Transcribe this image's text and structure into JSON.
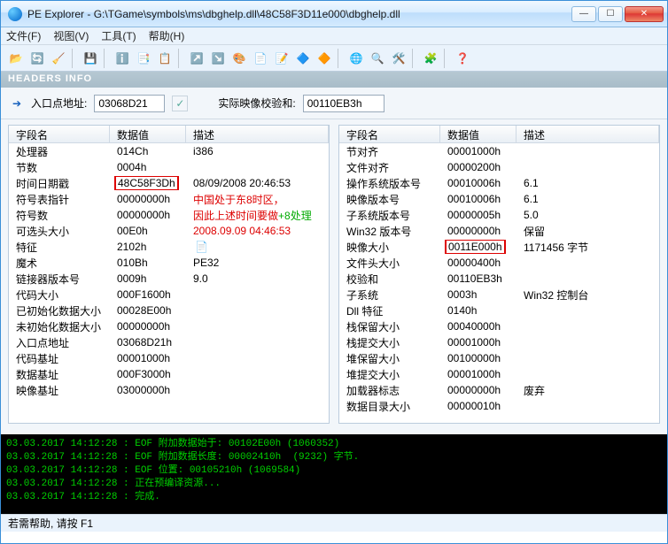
{
  "titlebar": {
    "title": "PE Explorer - G:\\TGame\\symbols\\ms\\dbghelp.dll\\48C58F3D11e000\\dbghelp.dll"
  },
  "menu": {
    "file": "文件(F)",
    "view": "视图(V)",
    "tools": "工具(T)",
    "help": "帮助(H)"
  },
  "headersInfo": "HEADERS INFO",
  "entrybar": {
    "ep_label": "入口点地址:",
    "ep_value": "03068D21",
    "checksum_label": "实际映像校验和:",
    "checksum_value": "00110EB3h"
  },
  "leftColumns": {
    "c1": "字段名",
    "c2": "数据值",
    "c3": "描述"
  },
  "rightColumns": {
    "c1": "字段名",
    "c2": "数据值",
    "c3": "描述"
  },
  "leftRows": [
    {
      "name": "处理器",
      "value": "014Ch",
      "desc": "i386"
    },
    {
      "name": "节数",
      "value": "0004h",
      "desc": ""
    },
    {
      "name": "时间日期戳",
      "value": "48C58F3Dh",
      "desc": "08/09/2008 20:46:53",
      "vbox": true
    },
    {
      "name": "符号表指针",
      "value": "00000000h",
      "desc": "中国处于东8时区，",
      "red": true
    },
    {
      "name": "符号数",
      "value": "00000000h",
      "desc": "因此上述时间要做+8处理",
      "red": true,
      "red_green_tail": "+8处理"
    },
    {
      "name": "可选头大小",
      "value": "00E0h",
      "desc": "2008.09.09  04:46:53",
      "red": true
    },
    {
      "name": "特征",
      "value": "2102h",
      "desc": ""
    },
    {
      "name": "魔术",
      "value": "010Bh",
      "desc": "PE32"
    },
    {
      "name": "链接器版本号",
      "value": "0009h",
      "desc": "9.0"
    },
    {
      "name": "代码大小",
      "value": "000F1600h",
      "desc": ""
    },
    {
      "name": "已初始化数据大小",
      "value": "00028E00h",
      "desc": ""
    },
    {
      "name": "未初始化数据大小",
      "value": "00000000h",
      "desc": ""
    },
    {
      "name": "入口点地址",
      "value": "03068D21h",
      "desc": ""
    },
    {
      "name": "代码基址",
      "value": "00001000h",
      "desc": ""
    },
    {
      "name": "数据基址",
      "value": "000F3000h",
      "desc": ""
    },
    {
      "name": "映像基址",
      "value": "03000000h",
      "desc": ""
    }
  ],
  "rightRows": [
    {
      "name": "节对齐",
      "value": "00001000h",
      "desc": ""
    },
    {
      "name": "文件对齐",
      "value": "00000200h",
      "desc": ""
    },
    {
      "name": "操作系统版本号",
      "value": "00010006h",
      "desc": "6.1"
    },
    {
      "name": "映像版本号",
      "value": "00010006h",
      "desc": "6.1"
    },
    {
      "name": "子系统版本号",
      "value": "00000005h",
      "desc": "5.0"
    },
    {
      "name": "Win32 版本号",
      "value": "00000000h",
      "desc": "保留"
    },
    {
      "name": "映像大小",
      "value": "0011E000h",
      "desc": "1171456 字节",
      "vbox": true
    },
    {
      "name": "文件头大小",
      "value": "00000400h",
      "desc": ""
    },
    {
      "name": "校验和",
      "value": "00110EB3h",
      "desc": ""
    },
    {
      "name": "子系统",
      "value": "0003h",
      "desc": "Win32 控制台"
    },
    {
      "name": "Dll 特征",
      "value": "0140h",
      "desc": ""
    },
    {
      "name": "栈保留大小",
      "value": "00040000h",
      "desc": ""
    },
    {
      "name": "栈提交大小",
      "value": "00001000h",
      "desc": ""
    },
    {
      "name": "堆保留大小",
      "value": "00100000h",
      "desc": ""
    },
    {
      "name": "堆提交大小",
      "value": "00001000h",
      "desc": ""
    },
    {
      "name": "加载器标志",
      "value": "00000000h",
      "desc": "废弃"
    },
    {
      "name": "数据目录大小",
      "value": "00000010h",
      "desc": ""
    }
  ],
  "console": [
    "03.03.2017 14:12:28 : EOF 附加数据始于: 00102E00h (1060352)",
    "03.03.2017 14:12:28 : EOF 附加数据长度: 00002410h  (9232) 字节.",
    "03.03.2017 14:12:28 : EOF 位置: 00105210h (1069584)",
    "03.03.2017 14:12:28 : 正在预编译资源...",
    "03.03.2017 14:12:28 : 完成."
  ],
  "status": "若需帮助, 请按 F1"
}
